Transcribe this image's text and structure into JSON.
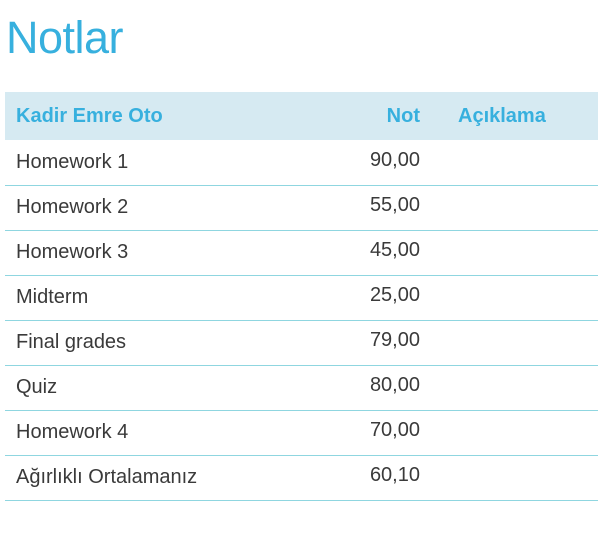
{
  "page": {
    "title": "Notlar"
  },
  "table": {
    "headers": {
      "name": "Kadir Emre Oto",
      "grade": "Not",
      "note": "Açıklama"
    },
    "rows": [
      {
        "name": "Homework 1",
        "grade": "90,00",
        "note": ""
      },
      {
        "name": "Homework 2",
        "grade": "55,00",
        "note": ""
      },
      {
        "name": "Homework 3",
        "grade": "45,00",
        "note": ""
      },
      {
        "name": "Midterm",
        "grade": "25,00",
        "note": ""
      },
      {
        "name": "Final grades",
        "grade": "79,00",
        "note": ""
      },
      {
        "name": "Quiz",
        "grade": "80,00",
        "note": ""
      },
      {
        "name": "Homework 4",
        "grade": "70,00",
        "note": ""
      },
      {
        "name": "Ağırlıklı Ortalamanız",
        "grade": "60,10",
        "note": ""
      }
    ]
  },
  "colors": {
    "accent": "#37b0de",
    "header_background": "#d6eaf2",
    "row_divider": "#8fd6e0",
    "text": "#3a3a3a"
  }
}
